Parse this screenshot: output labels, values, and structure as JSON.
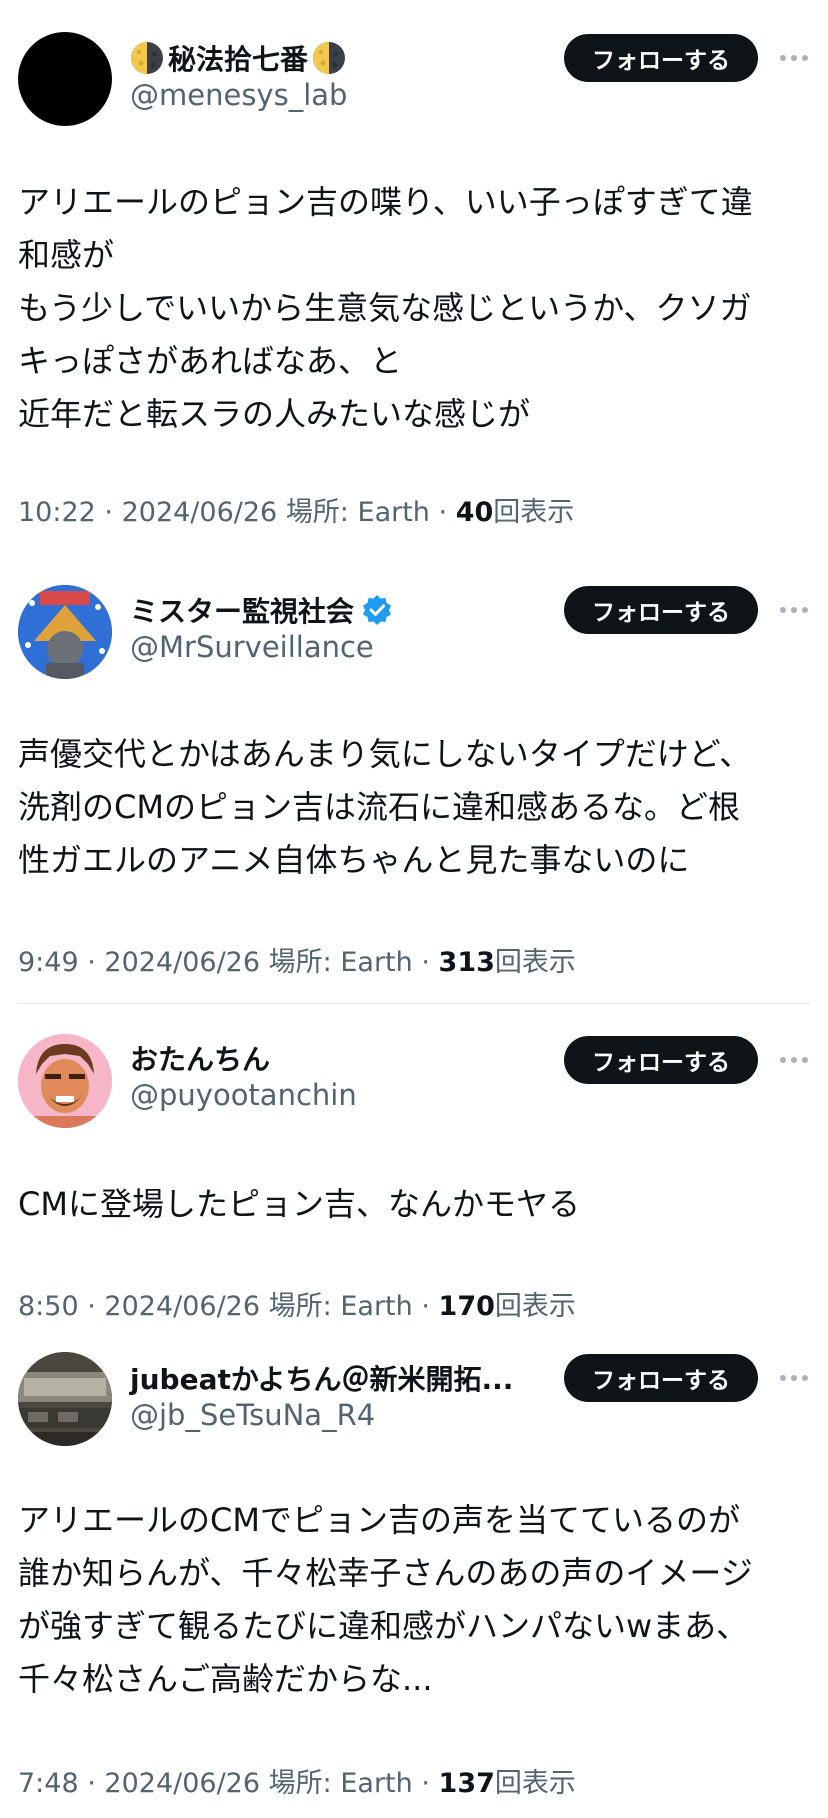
{
  "tweets": [
    {
      "display_name": "秘法拾七番",
      "handle": "@menesys_lab",
      "verified": false,
      "follow_label": "フォローする",
      "lines": [
        "アリエールのピョン吉の喋り、いい子っぽすぎて違",
        "和感が",
        "もう少しでいいから生意気な感じというか、クソガ",
        "キっぽさがあればなあ、と",
        "近年だと転スラの人みたいな感じが"
      ],
      "time": "10:22",
      "date": "2024/06/26",
      "location_label": "場所:",
      "location": "Earth",
      "views": "40",
      "views_label": "回表示"
    },
    {
      "display_name": "ミスター監視社会",
      "handle": "@MrSurveillance",
      "verified": true,
      "follow_label": "フォローする",
      "lines": [
        "声優交代とかはあんまり気にしないタイプだけど、",
        "洗剤のCMのピョン吉は流石に違和感あるな。ど根",
        "性ガエルのアニメ自体ちゃんと見た事ないのに"
      ],
      "time": "9:49",
      "date": "2024/06/26",
      "location_label": "場所:",
      "location": "Earth",
      "views": "313",
      "views_label": "回表示"
    },
    {
      "display_name": "おたんちん",
      "handle": "@puyootanchin",
      "verified": false,
      "follow_label": "フォローする",
      "lines": [
        "CMに登場したピョン吉、なんかモヤる"
      ],
      "time": "8:50",
      "date": "2024/06/26",
      "location_label": "場所:",
      "location": "Earth",
      "views": "170",
      "views_label": "回表示"
    },
    {
      "display_name": "jubeatかよちん＠新米開拓...",
      "handle": "@jb_SeTsuNa_R4",
      "verified": false,
      "follow_label": "フォローする",
      "lines": [
        "アリエールのCMでピョン吉の声を当てているのが",
        "誰か知らんが、千々松幸子さんのあの声のイメージ",
        "が強すぎて観るたびに違和感がハンパないwまあ、",
        "千々松さんご高齢だからな..."
      ],
      "time": "7:48",
      "date": "2024/06/26",
      "location_label": "場所:",
      "location": "Earth",
      "views": "137",
      "views_label": "回表示"
    }
  ],
  "meta_separator": "·",
  "colors": {
    "text": "#0f1419",
    "secondary": "#536471",
    "follow_bg": "#0f1419",
    "verified": "#1d9bf0",
    "divider": "#e6e9eb"
  },
  "icons": {
    "moon": "half-moon-emoji-icon",
    "verified": "verified-badge-icon",
    "more": "more-dots-icon"
  }
}
